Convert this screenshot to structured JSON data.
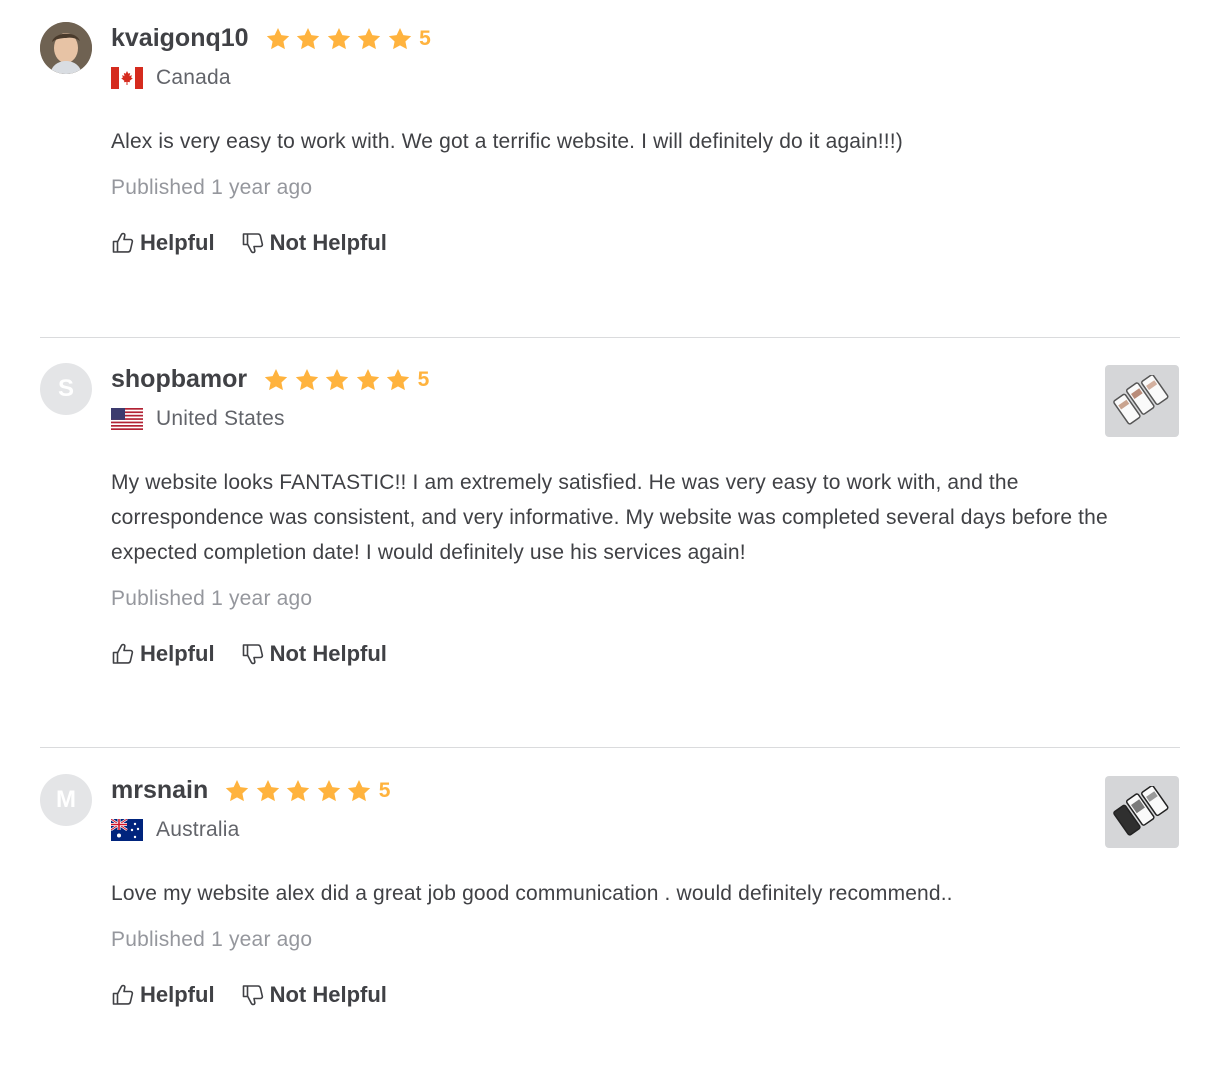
{
  "reviews": [
    {
      "username": "kvaigonq10",
      "rating": "5",
      "country": "Canada",
      "flag": "canada-flag-icon",
      "text": "Alex is very easy to work with. We got a terrific website. I will definitely do it again!!!)",
      "published": "Published 1 year ago",
      "helpful": "Helpful",
      "not_helpful": "Not Helpful",
      "avatar": "user-photo"
    },
    {
      "username": "shopbamor",
      "rating": "5",
      "country": "United States",
      "flag": "united-states-flag-icon",
      "text": "My website looks FANTASTIC!! I am extremely satisfied. He was very easy to work with, and the correspondence was consistent, and very informative. My website was completed several days before the expected completion date! I would definitely use his services again!",
      "published": "Published 1 year ago",
      "helpful": "Helpful",
      "not_helpful": "Not Helpful",
      "avatar_letter": "S"
    },
    {
      "username": "mrsnain",
      "rating": "5",
      "country": "Australia",
      "flag": "australia-flag-icon",
      "text": "Love my website alex did a great job good communication . would definitely recommend..",
      "published": "Published 1 year ago",
      "helpful": "Helpful",
      "not_helpful": "Not Helpful",
      "avatar_letter": "M"
    }
  ],
  "colors": {
    "star": "#ffb33e",
    "text": "#404145",
    "muted": "#95979d",
    "divider": "#dadbdd"
  }
}
